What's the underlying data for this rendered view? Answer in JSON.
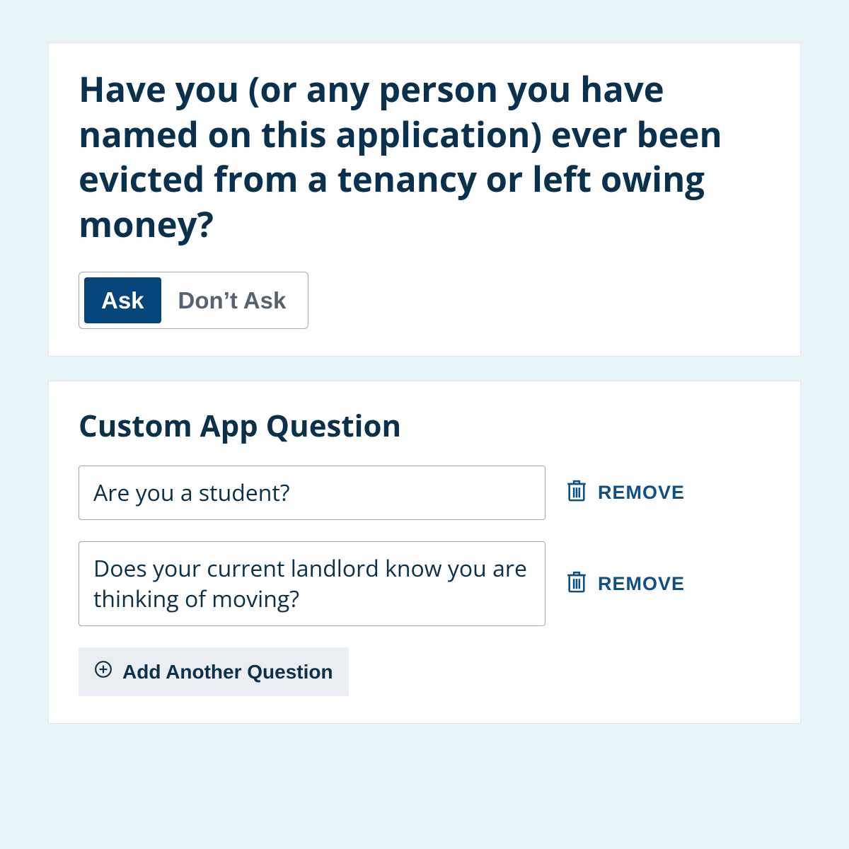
{
  "question_card": {
    "title": "Have you (or any person you have named on this application) ever been evicted from a tenancy or left owing money?",
    "ask_label": "Ask",
    "dont_ask_label": "Don’t Ask",
    "selected": "ask"
  },
  "custom_section": {
    "title": "Custom App Question",
    "questions": [
      {
        "text": "Are you a student?"
      },
      {
        "text": "Does your current landlord know you are thinking of moving?"
      }
    ],
    "remove_label": "REMOVE",
    "add_label": "Add Another Question"
  }
}
